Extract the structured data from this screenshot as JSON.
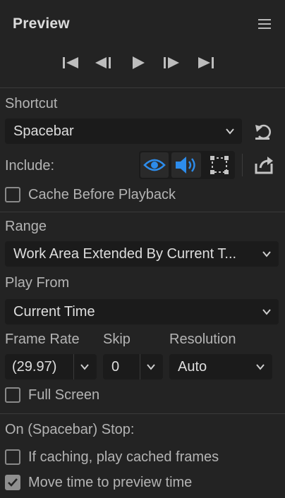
{
  "panel": {
    "title": "Preview",
    "menu_icon": "hamburger-menu-icon"
  },
  "transport": {
    "icons": [
      "first-frame-icon",
      "previous-frame-icon",
      "play-icon",
      "next-frame-icon",
      "last-frame-icon"
    ]
  },
  "shortcut": {
    "label": "Shortcut",
    "value": "Spacebar",
    "reset_icon": "reset-icon"
  },
  "include": {
    "label": "Include:",
    "video_icon": "eye-icon",
    "audio_icon": "speaker-icon",
    "overlays_icon": "overlays-icon",
    "export_icon": "export-icon",
    "accent_color": "#2d8ceb"
  },
  "cache_before_playback": {
    "label": "Cache Before Playback",
    "checked": false
  },
  "range": {
    "label": "Range",
    "value": "Work Area Extended By Current T..."
  },
  "play_from": {
    "label": "Play From",
    "value": "Current Time"
  },
  "frame_rate": {
    "label": "Frame Rate",
    "value": "(29.97)"
  },
  "skip": {
    "label": "Skip",
    "value": "0"
  },
  "resolution": {
    "label": "Resolution",
    "value": "Auto"
  },
  "full_screen": {
    "label": "Full Screen",
    "checked": false
  },
  "stop": {
    "label": "On (Spacebar) Stop:",
    "if_caching": {
      "label": "If caching, play cached frames",
      "checked": false
    },
    "move_time": {
      "label": "Move time to preview time",
      "checked": true
    }
  }
}
